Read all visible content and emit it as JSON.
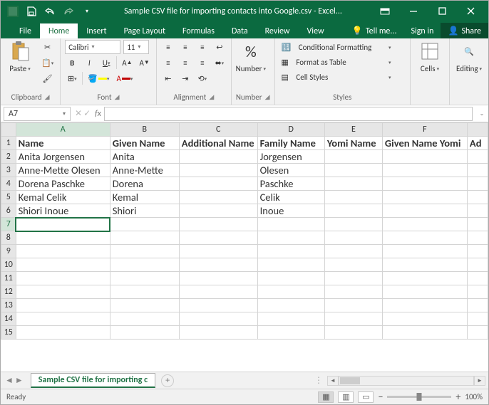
{
  "title": "Sample CSV file for importing contacts into Google.csv - Excel...",
  "tabs": {
    "file": "File",
    "home": "Home",
    "insert": "Insert",
    "pageLayout": "Page Layout",
    "formulas": "Formulas",
    "data": "Data",
    "review": "Review",
    "view": "View",
    "tellMe": "Tell me...",
    "signIn": "Sign in",
    "share": "Share"
  },
  "ribbon": {
    "clipboard": {
      "paste": "Paste",
      "label": "Clipboard"
    },
    "font": {
      "name": "Calibri",
      "size": "11",
      "bold": "B",
      "italic": "I",
      "underline": "U",
      "label": "Font"
    },
    "alignment": {
      "label": "Alignment"
    },
    "number": {
      "pct": "%",
      "btn": "Number",
      "label": "Number"
    },
    "styles": {
      "cond": "Conditional Formatting",
      "fat": "Format as Table",
      "cell": "Cell Styles",
      "label": "Styles"
    },
    "cells": {
      "btn": "Cells"
    },
    "editing": {
      "btn": "Editing"
    }
  },
  "nameBox": "A7",
  "fx": "fx",
  "formula": "",
  "columns": [
    "A",
    "B",
    "C",
    "D",
    "E",
    "F"
  ],
  "partialCol": "Ad",
  "headers": [
    "Name",
    "Given Name",
    "Additional Name",
    "Family Name",
    "Yomi Name",
    "Given Name Yomi"
  ],
  "rows": [
    {
      "n": "2",
      "c": [
        "Anita Jorgensen",
        "Anita",
        "",
        "Jorgensen",
        "",
        ""
      ]
    },
    {
      "n": "3",
      "c": [
        "Anne-Mette Olesen",
        "Anne-Mette",
        "",
        "Olesen",
        "",
        ""
      ]
    },
    {
      "n": "4",
      "c": [
        "Dorena Paschke",
        "Dorena",
        "",
        "Paschke",
        "",
        ""
      ]
    },
    {
      "n": "5",
      "c": [
        "Kemal Celik",
        "Kemal",
        "",
        "Celik",
        "",
        ""
      ]
    },
    {
      "n": "6",
      "c": [
        "Shiori Inoue",
        "Shiori",
        "",
        "Inoue",
        "",
        ""
      ]
    }
  ],
  "emptyRows": [
    "7",
    "8",
    "9",
    "10",
    "11",
    "12",
    "13",
    "14",
    "15"
  ],
  "sheetTab": "Sample CSV file for importing c",
  "status": {
    "ready": "Ready",
    "zoom": "100%"
  },
  "zoomMinus": "−",
  "zoomPlus": "+"
}
